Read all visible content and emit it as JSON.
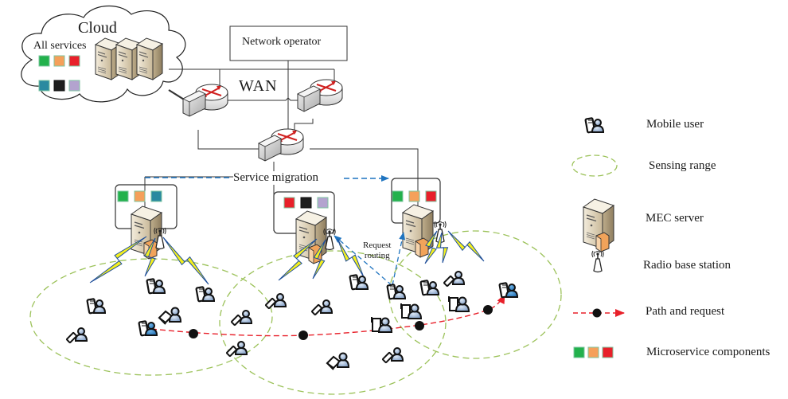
{
  "cloud": {
    "title": "Cloud",
    "services_label": "All services",
    "service_colors": [
      "#22b14c",
      "#f5a05a",
      "#e8202a",
      "#2a8aa0",
      "#1e1e1e",
      "#b3a3cf"
    ]
  },
  "network_operator": {
    "label": "Network operator"
  },
  "wan": {
    "label": "WAN"
  },
  "annotations": {
    "service_migration": "Service migration",
    "request_routing_line1": "Request",
    "request_routing_line2": "routing"
  },
  "edge_nodes": [
    {
      "name": "edge-node-left",
      "microservices": [
        "#22b14c",
        "#f5a05a",
        "#2a8aa0"
      ]
    },
    {
      "name": "edge-node-middle",
      "microservices": [
        "#e8202a",
        "#1e1e1e",
        "#b3a3cf"
      ]
    },
    {
      "name": "edge-node-right",
      "microservices": [
        "#22b14c",
        "#f5a05a",
        "#e8202a"
      ]
    }
  ],
  "legend": {
    "items": [
      {
        "icon": "mobile-user-icon",
        "label": "Mobile user"
      },
      {
        "icon": "sensing-range-icon",
        "label": "Sensing range"
      },
      {
        "icon": "mec-server-icon",
        "label": "MEC server"
      },
      {
        "icon": "radio-base-station-icon",
        "label": "Radio base station"
      },
      {
        "icon": "path-request-icon",
        "label": "Path and request"
      },
      {
        "icon": "microservice-components-icon",
        "label": "Microservice components"
      }
    ],
    "microservice_colors": [
      "#22b14c",
      "#f5a05a",
      "#e8202a"
    ]
  },
  "colors": {
    "sensing_range": "#9cc25a",
    "path": "#e8202a",
    "migration_arrow": "#1f74c0",
    "lightning_fill": "#f4ef1e",
    "lightning_stroke": "#1f4f9a",
    "router_arrow": "#d0201f"
  }
}
